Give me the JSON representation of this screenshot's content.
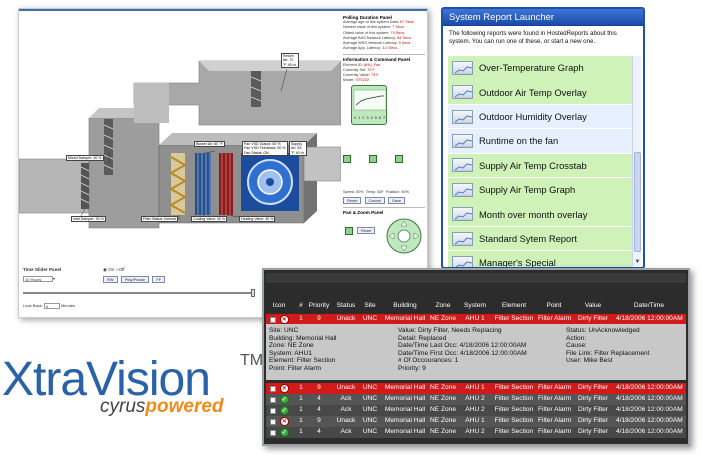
{
  "hvac": {
    "polling": {
      "title": "Polling Duration Panel",
      "lines": [
        {
          "label": "Average age of this system Data: ",
          "value": "67 Secs."
        },
        {
          "label": "Newest value of this system: ",
          "value": "7 Secs."
        },
        {
          "label": "Oldest value of this system: ",
          "value": "74 Secs."
        },
        {
          "label": "Average BAS Network Latency: ",
          "value": "64 Secs."
        },
        {
          "label": "Average WSG Network Latency: ",
          "value": "5 Secs."
        },
        {
          "label": "Average App. Latency: ",
          "value": "3.0 Secs."
        }
      ]
    },
    "info": {
      "title": "Information & Command Panel",
      "lines": [
        {
          "label": "Element ID: ",
          "value": "AHU_Fan"
        },
        {
          "label": "Currently Set: ",
          "value": "70 F"
        },
        {
          "label": "Currently Value: ",
          "value": "73 F"
        },
        {
          "label": "Model: ",
          "value": "STS222"
        }
      ],
      "chart_ticks": "0 1 2 3 4 5 6 7",
      "speed_text": "Speed: 50%",
      "temp_text": "Temp: 53F",
      "position_text": "Position: 50%",
      "buttons": [
        "Reset",
        "Cancel",
        "Save"
      ]
    },
    "panzoom": {
      "title": "Pan & Zoom Panel",
      "reset": "Reset"
    },
    "tags": {
      "return_air": "Return Air: 72 °F 45 rh",
      "mixed_damper": "Mixed Damper: 30 %",
      "blower_air": "Blower Air: 60 °F",
      "fan_vsd": "Fan VSD Output: 50 %",
      "fan_feedback": "Fan VSD Feedback: 50 %",
      "fan_status": "Fan Status: ON",
      "supply_air": "Supply Air: 53 °F 40 rh",
      "inlet_damper": "Inlet Damper: 30 %",
      "filter_status": "Filter Status: Normal",
      "cooling_valve": "Cooling Valve: 30 %",
      "heating_valve": "Heating Valve: 40 %"
    },
    "time_slider": {
      "title": "Time Slider Panel",
      "on": "On",
      "off": "Off",
      "hours": "10 Hours",
      "rw": "RW",
      "play": "Play/Pause",
      "ff": "FF",
      "look_back": "Look Back:",
      "look_val": "0",
      "minutes": "Minutes"
    }
  },
  "launcher": {
    "title": "System Report Launcher",
    "intro": "The following reports were found in HostedReports about this system. You can run one of these, or start a new one.",
    "reports": [
      "Over-Temperature Graph",
      "Outdoor Air Temp Overlay",
      "Outdoor Humidity Overlay",
      "Runtime on the fan",
      "Supply Air Temp Crosstab",
      "Supply Air Temp Graph",
      "Month over month overlay",
      "Standard Sytem Report",
      "Manager's Special"
    ]
  },
  "logo": {
    "main": "XtraVision",
    "tm": "TM",
    "sub_cyrus": "cyrus",
    "sub_powered": "powered"
  },
  "alarm": {
    "columns": [
      "Icon",
      "#",
      "Priority",
      "Status",
      "Site",
      "Building",
      "Zone",
      "System",
      "Element",
      "Point",
      "Value",
      "Date/Time"
    ],
    "rows": [
      {
        "num": "1",
        "priority": "9",
        "status": "Unack",
        "site": "UNC",
        "building": "Memorial Hall",
        "zone": "NE Zone",
        "system": "AHU 1",
        "element": "Filter Section",
        "point": "Filter Alarm",
        "value": "Dirty Filter",
        "datetime": "4/18/2006 12:00:00AM"
      },
      {
        "num": "1",
        "priority": "9",
        "status": "Unack",
        "site": "UNC",
        "building": "Memorial Hall",
        "zone": "NE Zone",
        "system": "AHU 1",
        "element": "Filter Section",
        "point": "Filter Alarm",
        "value": "Dirty Filter",
        "datetime": "4/18/2006 12:00:00AM"
      },
      {
        "num": "1",
        "priority": "4",
        "status": "Ack",
        "site": "UNC",
        "building": "Memorial Hall",
        "zone": "NE Zone",
        "system": "AHU 2",
        "element": "Filter Section",
        "point": "Filter Alarm",
        "value": "Dirty Filter",
        "datetime": "4/18/2006 12:00:00AM"
      },
      {
        "num": "1",
        "priority": "4",
        "status": "Ack",
        "site": "UNC",
        "building": "Memorial Hall",
        "zone": "NE Zone",
        "system": "AHU 2",
        "element": "Filter Section",
        "point": "Filter Alarm",
        "value": "Dirty Filter",
        "datetime": "4/18/2006 12:00:00AM"
      },
      {
        "num": "1",
        "priority": "9",
        "status": "Unack",
        "site": "UNC",
        "building": "Memorial Hall",
        "zone": "NE Zone",
        "system": "AHU 1",
        "element": "Filter Section",
        "point": "Filter Alarm",
        "value": "Dirty Filter",
        "datetime": "4/18/2006 12:00:00AM"
      },
      {
        "num": "1",
        "priority": "4",
        "status": "Ack",
        "site": "UNC",
        "building": "Memorial Hall",
        "zone": "NE Zone",
        "system": "AHU 2",
        "element": "Filter Section",
        "point": "Filter Alarm",
        "value": "Dirty Filter",
        "datetime": "4/18/2006 12:00:00AM"
      }
    ],
    "detail": {
      "col1": [
        "Site: UNC",
        "Building: Memorial Hall",
        "Zone: NE Zone",
        "System: AHU1",
        "Element: Filter Section",
        "Point: Filter Alarm"
      ],
      "col2": [
        "Value: Dirty Filter, Needs Replacing",
        "Detail: Replaced",
        "Date/Time Last Occ: 4/18/2006 12:00:00AM",
        "Date/Time First Occ: 4/18/2006 12:00:00AM",
        "# Of Occourances: 1",
        "Priority: 9"
      ],
      "col3": [
        "Status: UnAcknowledged",
        "Action:",
        "Cause:",
        "File Link: Filter Replacement",
        "User: Mike Best"
      ]
    }
  }
}
